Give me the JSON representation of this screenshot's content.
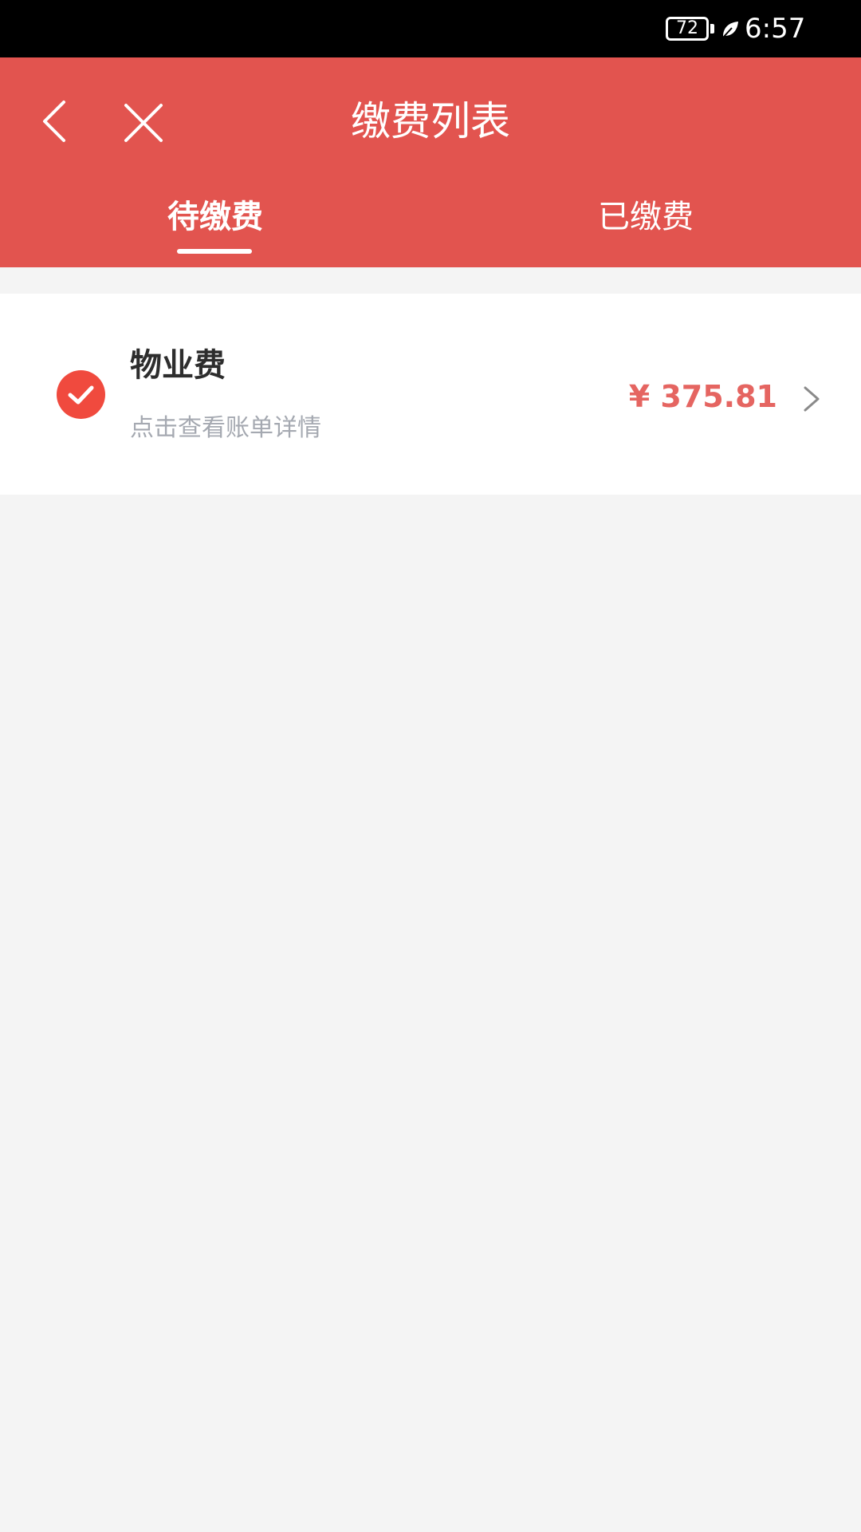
{
  "status_bar": {
    "battery_level": "72",
    "time": "6:57",
    "icons": [
      "battery-icon",
      "leaf-icon"
    ]
  },
  "header": {
    "title": "缴费列表",
    "back_icon": "chevron-left-icon",
    "close_icon": "close-icon",
    "background_color": "#e2544f"
  },
  "tabs": [
    {
      "label": "待缴费",
      "active": true
    },
    {
      "label": "已缴费",
      "active": false
    }
  ],
  "bills": [
    {
      "name": "物业费",
      "hint": "点击查看账单详情",
      "amount": "¥ 375.81",
      "selected": true,
      "check_icon": "check-circle-icon",
      "arrow_icon": "chevron-right-icon"
    }
  ],
  "colors": {
    "accent": "#e2544f",
    "check": "#f04a3e",
    "amount": "#e56561",
    "hint": "#a5a9b1",
    "page_background": "#f4f4f4"
  }
}
